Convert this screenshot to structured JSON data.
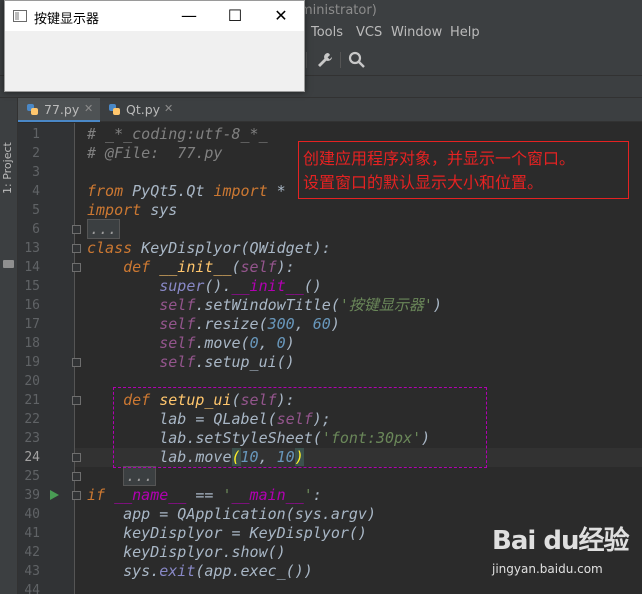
{
  "window": {
    "title_partial": "ministrator)"
  },
  "menu": [
    {
      "label": "Tools"
    },
    {
      "label": "VCS"
    },
    {
      "label": "Window"
    },
    {
      "label": "Help"
    }
  ],
  "toolbar": {
    "icons": [
      "wrench-icon",
      "search-icon"
    ]
  },
  "side_panel": {
    "label": "1: Project"
  },
  "tabs": [
    {
      "label": "77.py",
      "active": true
    },
    {
      "label": "Qt.py",
      "active": false
    }
  ],
  "code": {
    "current_line": "24",
    "lines": [
      {
        "n": "1",
        "text": "# _*_coding:utf-8_*_"
      },
      {
        "n": "2",
        "text": "# @File:  77.py"
      },
      {
        "n": "3",
        "text": ""
      },
      {
        "n": "4",
        "text": "from PyQt5.Qt import *"
      },
      {
        "n": "5",
        "text": "import sys"
      },
      {
        "n": "6",
        "text": "..."
      },
      {
        "n": "13",
        "text": "class KeyDisplyor(QWidget):"
      },
      {
        "n": "14",
        "text": "    def __init__(self):"
      },
      {
        "n": "15",
        "text": "        super().__init__()"
      },
      {
        "n": "16",
        "text": "        self.setWindowTitle('按键显示器')"
      },
      {
        "n": "17",
        "text": "        self.resize(300, 60)"
      },
      {
        "n": "18",
        "text": "        self.move(0, 0)"
      },
      {
        "n": "19",
        "text": "        self.setup_ui()"
      },
      {
        "n": "20",
        "text": ""
      },
      {
        "n": "21",
        "text": "    def setup_ui(self):"
      },
      {
        "n": "22",
        "text": "        lab = QLabel(self);"
      },
      {
        "n": "23",
        "text": "        lab.setStyleSheet('font:30px')"
      },
      {
        "n": "24",
        "text": "        lab.move(10, 10)"
      },
      {
        "n": "25",
        "text": "    ..."
      },
      {
        "n": "39",
        "text": "if __name__ == '__main__':"
      },
      {
        "n": "40",
        "text": "    app = QApplication(sys.argv)"
      },
      {
        "n": "41",
        "text": "    keyDisplyor = KeyDisplyor()"
      },
      {
        "n": "42",
        "text": "    keyDisplyor.show()"
      },
      {
        "n": "43",
        "text": "    sys.exit(app.exec_())"
      },
      {
        "n": "44",
        "text": ""
      }
    ]
  },
  "annotation": {
    "line1": "创建应用程序对象，并显示一个窗口。",
    "line2": "设置窗口的默认显示大小和位置。"
  },
  "qt_window": {
    "title": "按键显示器",
    "minimize": "—",
    "maximize": "☐",
    "close": "✕"
  },
  "watermark": {
    "brand": "Bai du经验",
    "url": "jingyan.baidu.com"
  },
  "colors": {
    "keyword": "#cc7832",
    "comment": "#808080",
    "string": "#6a8759",
    "number": "#6897bb",
    "self": "#94558d",
    "function": "#ffc66d",
    "annotation": "#e52222"
  }
}
